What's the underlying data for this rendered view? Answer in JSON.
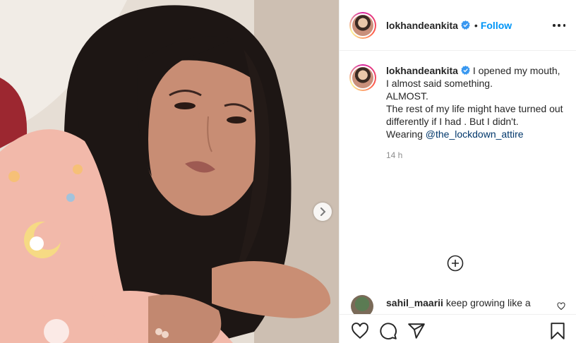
{
  "post": {
    "author": {
      "username": "lokhandeankita",
      "verified": true,
      "follow_label": "Follow",
      "separator": "•"
    },
    "caption": {
      "username": "lokhandeankita",
      "first_line": "I opened my mouth,",
      "lines": [
        "I almost said something.",
        "ALMOST.",
        "The rest of my life might have turned out differently if I had . But I didn't."
      ],
      "wearing_prefix": "Wearing ",
      "mention": "@the_lockdown_attire",
      "timestamp": "14 h"
    },
    "comment": {
      "username": "sahil_maarii",
      "text": "keep growing like a"
    }
  },
  "icons": {
    "header": [
      "verified-badge-icon",
      "more-options-icon"
    ],
    "media": [
      "chevron-right-icon"
    ],
    "comments": [
      "plus-circle-icon",
      "heart-small-icon"
    ],
    "actions": [
      "heart-icon",
      "comment-icon",
      "share-icon",
      "bookmark-icon"
    ]
  },
  "colors": {
    "accent": "#0095f6",
    "verified": "#3897f0",
    "text": "#262626",
    "muted": "#8e8e8e",
    "mention": "#00376b",
    "border": "#efefef"
  }
}
